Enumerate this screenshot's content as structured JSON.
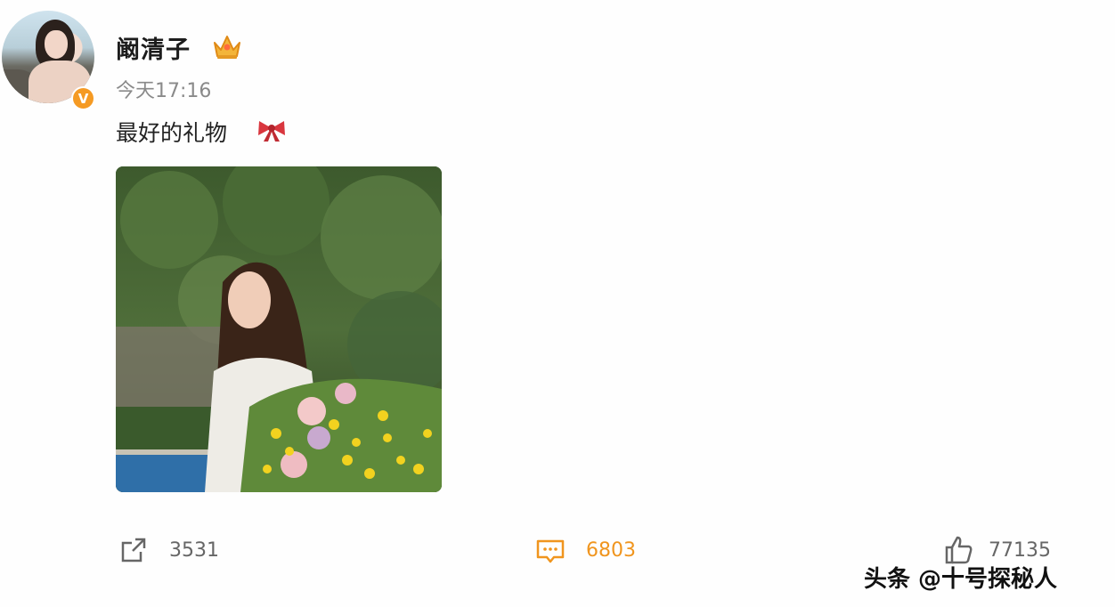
{
  "post": {
    "username": "阚清子",
    "crown_icon": "crown-icon",
    "verified_badge": "V",
    "timestamp": "今天17:16",
    "text": "最好的礼物",
    "text_emoji": "bow-icon",
    "image_alt": "woman-holding-flower-bouquet-photo"
  },
  "actions": {
    "repost_count": "3531",
    "comment_count": "6803",
    "like_count": "77135"
  },
  "watermark": "头条 @十号探秘人",
  "colors": {
    "accent_orange": "#f0951e",
    "badge_orange": "#f59a23",
    "bow_red": "#d9363e"
  }
}
